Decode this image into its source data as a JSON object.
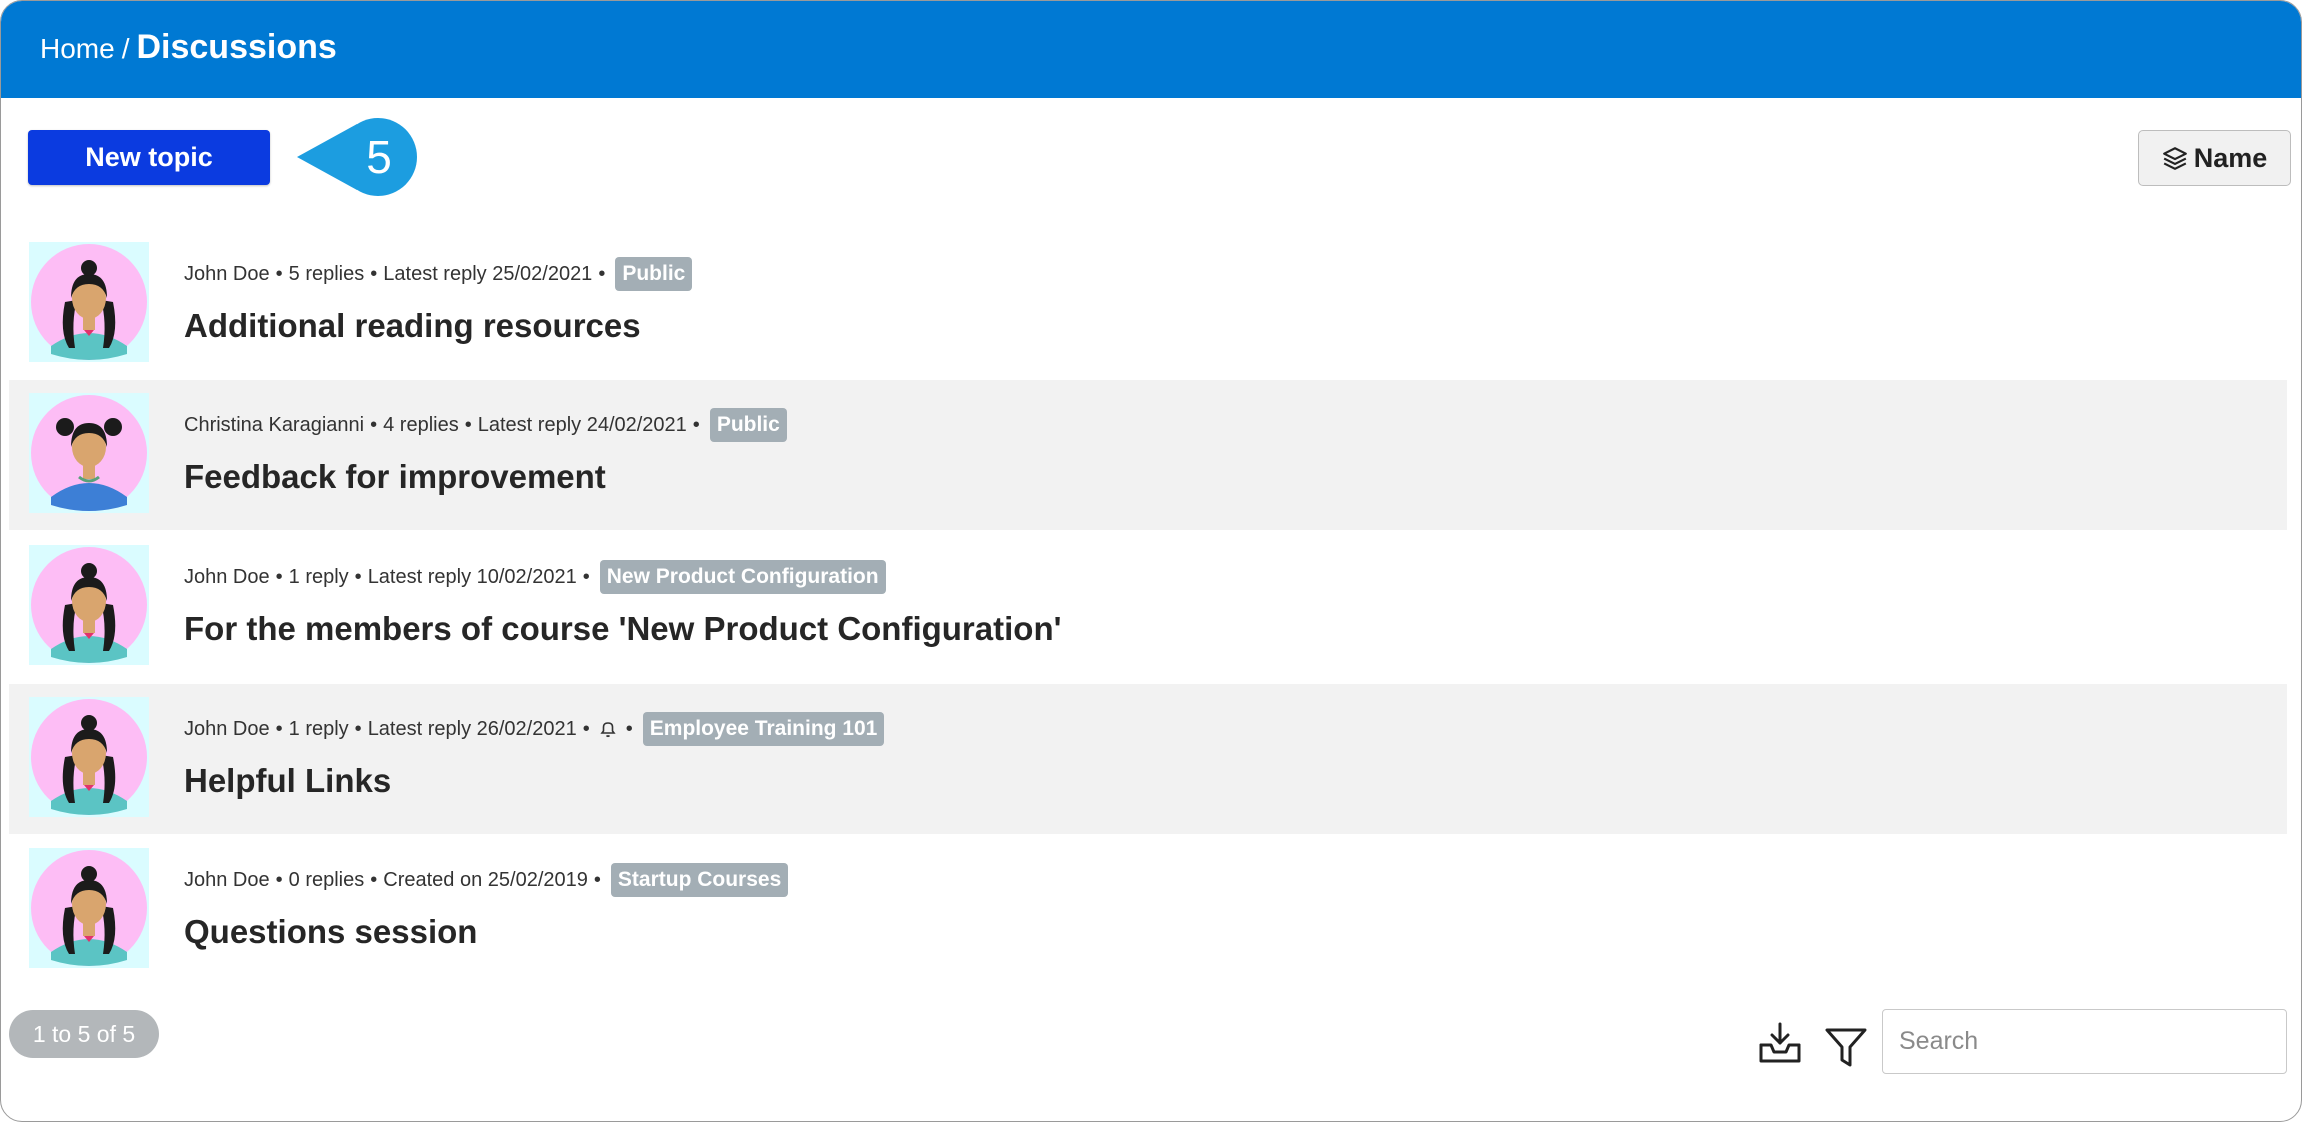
{
  "header": {
    "home_label": "Home",
    "separator": "/",
    "current_page": "Discussions"
  },
  "toolbar": {
    "new_topic_label": "New topic",
    "callout_number": "5",
    "sort_label": "Name"
  },
  "topics": [
    {
      "author": "John Doe",
      "replies": "5 replies",
      "latest": "Latest reply 25/02/2021",
      "has_bell": false,
      "tag": "Public",
      "title": "Additional reading resources",
      "avatar": "girl-ponytail"
    },
    {
      "author": "Christina Karagianni",
      "replies": "4 replies",
      "latest": "Latest reply 24/02/2021",
      "has_bell": false,
      "tag": "Public",
      "title": "Feedback for improvement",
      "avatar": "girl-pigtails"
    },
    {
      "author": "John Doe",
      "replies": "1 reply",
      "latest": "Latest reply 10/02/2021",
      "has_bell": false,
      "tag": "New Product Configuration",
      "title": "For the members of course 'New Product Configuration'",
      "avatar": "girl-ponytail"
    },
    {
      "author": "John Doe",
      "replies": "1 reply",
      "latest": "Latest reply 26/02/2021",
      "has_bell": true,
      "tag": "Employee Training 101",
      "title": "Helpful Links",
      "avatar": "girl-ponytail"
    },
    {
      "author": "John Doe",
      "replies": "0 replies",
      "latest": "Created on 25/02/2019",
      "has_bell": false,
      "tag": "Startup Courses",
      "title": "Questions session",
      "avatar": "girl-ponytail"
    }
  ],
  "footer": {
    "pager_text": "1 to 5 of 5",
    "search_placeholder": "Search",
    "download_icon": "download-tray-icon",
    "filter_icon": "filter-funnel-icon"
  },
  "colors": {
    "header_bg": "#0079d3",
    "primary_button": "#0b3be0",
    "callout": "#1c9de0",
    "tag_bg": "#a3aeb5",
    "alt_row": "#f2f2f2"
  }
}
